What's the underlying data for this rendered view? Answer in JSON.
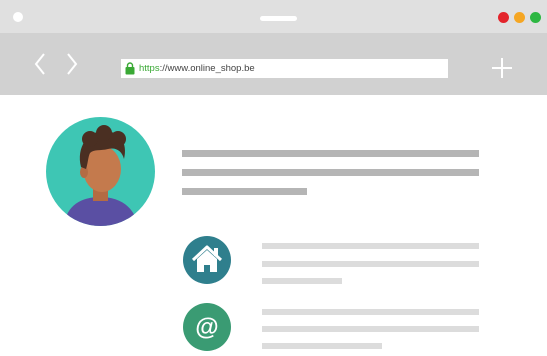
{
  "window": {
    "buttons": [
      {
        "name": "close",
        "color": "#e3242b"
      },
      {
        "name": "minimize",
        "color": "#f5a623"
      },
      {
        "name": "maximize",
        "color": "#2db742"
      }
    ]
  },
  "toolbar": {
    "nav_icon": "code-brackets-icon",
    "new_tab_icon": "plus-icon"
  },
  "address_bar": {
    "scheme": "https",
    "rest": "://www.online_shop.be",
    "lock_icon": "lock-icon",
    "secure_color": "#3aa935"
  },
  "profile": {
    "avatar_icon": "person-avatar-icon",
    "avatar_bg": "#3ec6b4"
  },
  "contacts": [
    {
      "icon": "home-icon",
      "color": "#2f7f8d"
    },
    {
      "icon": "at-sign-icon",
      "color": "#3a9b73",
      "symbol": "@"
    }
  ]
}
